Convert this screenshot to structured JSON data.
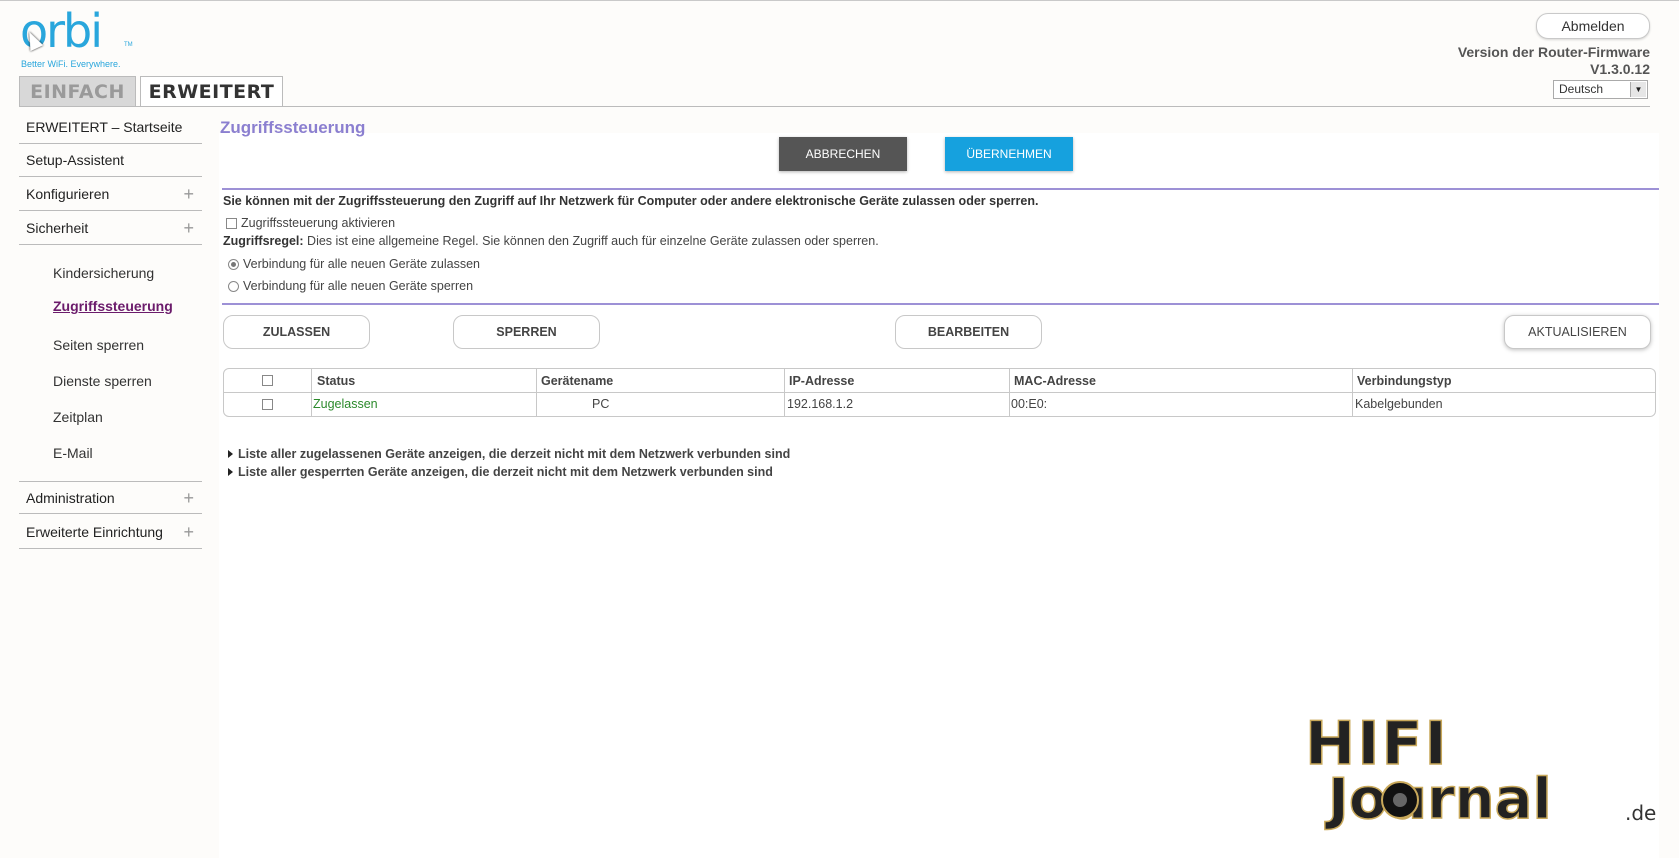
{
  "logo": {
    "word": "orbi",
    "tm": "TM",
    "tagline": "Better WiFi. Everywhere."
  },
  "tabs": {
    "simple": "EINFACH",
    "advanced": "ERWEITERT"
  },
  "header": {
    "logout": "Abmelden",
    "firmware_label": "Version der Router-Firmware",
    "firmware_version": "V1.3.0.12",
    "language": "Deutsch"
  },
  "sidebar": {
    "items": [
      {
        "label": "ERWEITERT – Startseite"
      },
      {
        "label": "Setup-Assistent"
      },
      {
        "label": "Konfigurieren",
        "plus": "+"
      },
      {
        "label": "Sicherheit",
        "plus": "+"
      }
    ],
    "sub_items": [
      {
        "label": "Kindersicherung"
      },
      {
        "label": "Zugriffssteuerung"
      },
      {
        "label": "Seiten sperren"
      },
      {
        "label": "Dienste sperren"
      },
      {
        "label": "Zeitplan"
      },
      {
        "label": "E-Mail"
      }
    ],
    "bottom_items": [
      {
        "label": "Administration",
        "plus": "+"
      },
      {
        "label": "Erweiterte Einrichtung",
        "plus": "+"
      }
    ]
  },
  "main": {
    "title": "Zugriffssteuerung",
    "cancel": "ABBRECHEN",
    "apply": "ÜBERNEHMEN",
    "intro": "Sie können mit der Zugriffssteuerung den Zugriff auf Ihr Netzwerk für Computer oder andere elektronische Geräte zulassen oder sperren.",
    "enable_label": "Zugriffssteuerung aktivieren",
    "rule_label": "Zugriffsregel:",
    "rule_text": " Dies ist eine allgemeine Regel. Sie können den Zugriff auch für einzelne Geräte zulassen oder sperren.",
    "radio_allow": "Verbindung für alle neuen Geräte zulassen",
    "radio_block": "Verbindung für alle neuen Geräte sperren",
    "btn_allow": "ZULASSEN",
    "btn_block": "SPERREN",
    "btn_edit": "BEARBEITEN",
    "btn_refresh": "AKTUALISIEREN",
    "table": {
      "headers": [
        "Status",
        "Gerätename",
        "IP-Adresse",
        "MAC-Adresse",
        "Verbindungstyp"
      ],
      "rows": [
        {
          "status": "Zugelassen",
          "device": "PC",
          "ip": "192.168.1.2",
          "mac": "00:E0:",
          "type": "Kabelgebunden"
        }
      ]
    },
    "expand_allowed": "Liste aller zugelassenen Geräte anzeigen, die derzeit nicht mit dem Netzwerk verbunden sind",
    "expand_blocked": "Liste aller gesperrten Geräte anzeigen, die derzeit nicht mit dem Netzwerk verbunden sind"
  },
  "watermark": {
    "text_main": "HIFI",
    "text_sub": "Journal",
    "text_tld": ".de"
  }
}
